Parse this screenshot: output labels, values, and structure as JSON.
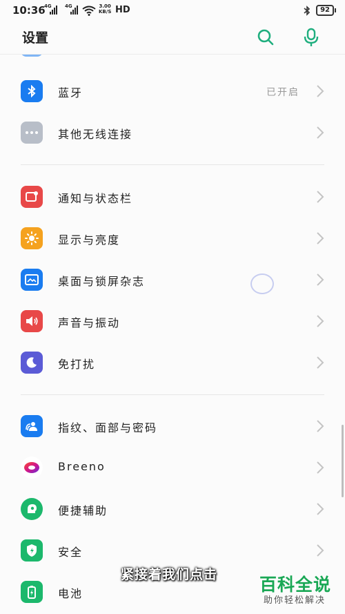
{
  "status_bar": {
    "time": "10:36",
    "sim1_tag": "4G",
    "sim2_tag": "4G",
    "speed_value": "3.00",
    "speed_unit": "KB/S",
    "hd": "HD",
    "battery": "92"
  },
  "header": {
    "title": "设置"
  },
  "rows": [
    {
      "label": "蓝牙",
      "value": "已开启",
      "icon": "bluetooth-icon",
      "color": "#1a7cf0"
    },
    {
      "label": "其他无线连接",
      "value": "",
      "icon": "more-dots-icon",
      "color": "#b8bec8"
    },
    {
      "label": "通知与状态栏",
      "value": "",
      "icon": "notification-icon",
      "color": "#e84848"
    },
    {
      "label": "显示与亮度",
      "value": "",
      "icon": "brightness-icon",
      "color": "#f5a21f"
    },
    {
      "label": "桌面与锁屏杂志",
      "value": "",
      "icon": "wallpaper-icon",
      "color": "#1a7cf0"
    },
    {
      "label": "声音与振动",
      "value": "",
      "icon": "speaker-icon",
      "color": "#e84848"
    },
    {
      "label": "免打扰",
      "value": "",
      "icon": "moon-icon",
      "color": "#5b5bd6"
    },
    {
      "label": "指纹、面部与密码",
      "value": "",
      "icon": "fingerprint-icon",
      "color": "#1a7cf0"
    },
    {
      "label": "Breeno",
      "value": "",
      "icon": "breeno-icon",
      "color": "#d0178a"
    },
    {
      "label": "便捷辅助",
      "value": "",
      "icon": "assist-icon",
      "color": "#1cb86c"
    },
    {
      "label": "安全",
      "value": "",
      "icon": "shield-icon",
      "color": "#1cb86c"
    },
    {
      "label": "电池",
      "value": "",
      "icon": "battery-icon",
      "color": "#1cb86c"
    }
  ],
  "caption": "紧接着我们点击",
  "watermark": {
    "title": "百科全说",
    "subtitle": "助你轻松解决"
  }
}
